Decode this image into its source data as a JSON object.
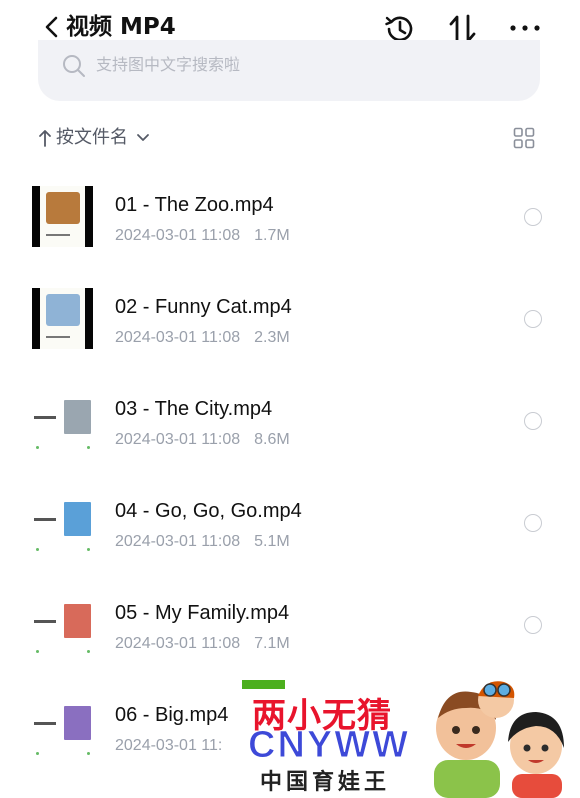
{
  "header": {
    "title": "视频 MP4",
    "icons": [
      "back-icon",
      "history-icon",
      "sort-icon",
      "more-icon"
    ]
  },
  "search": {
    "placeholder": "支持图中文字搜索啦"
  },
  "sort": {
    "label": "按文件名"
  },
  "files": [
    {
      "name": "01 - The Zoo.mp4",
      "date": "2024-03-01 11:08",
      "size": "1.7M",
      "thumb_style": "dark",
      "thumb_color": "#b87a3c"
    },
    {
      "name": "02 - Funny Cat.mp4",
      "date": "2024-03-01 11:08",
      "size": "2.3M",
      "thumb_style": "dark",
      "thumb_color": "#8fb3d6"
    },
    {
      "name": "03 - The City.mp4",
      "date": "2024-03-01 11:08",
      "size": "8.6M",
      "thumb_style": "light",
      "thumb_color": "#9aa6b0"
    },
    {
      "name": "04 - Go, Go, Go.mp4",
      "date": "2024-03-01 11:08",
      "size": "5.1M",
      "thumb_style": "light",
      "thumb_color": "#5aa0d8"
    },
    {
      "name": "05 - My Family.mp4",
      "date": "2024-03-01 11:08",
      "size": "7.1M",
      "thumb_style": "light",
      "thumb_color": "#d86a5a"
    },
    {
      "name": "06 - Big.mp4",
      "date": "2024-03-01 11:",
      "size": "",
      "thumb_style": "light",
      "thumb_color": "#8a6fc0"
    }
  ],
  "promo": {
    "line1": "两小无猜",
    "line2": "CNYWW",
    "line3": "中国育娃王"
  },
  "colors": {
    "accent_red": "#e8142c",
    "accent_blue": "#3d49d8",
    "accent_green": "#4caf1e",
    "meta_gray": "#9aa0ab",
    "search_bg": "#f1f2f6"
  }
}
